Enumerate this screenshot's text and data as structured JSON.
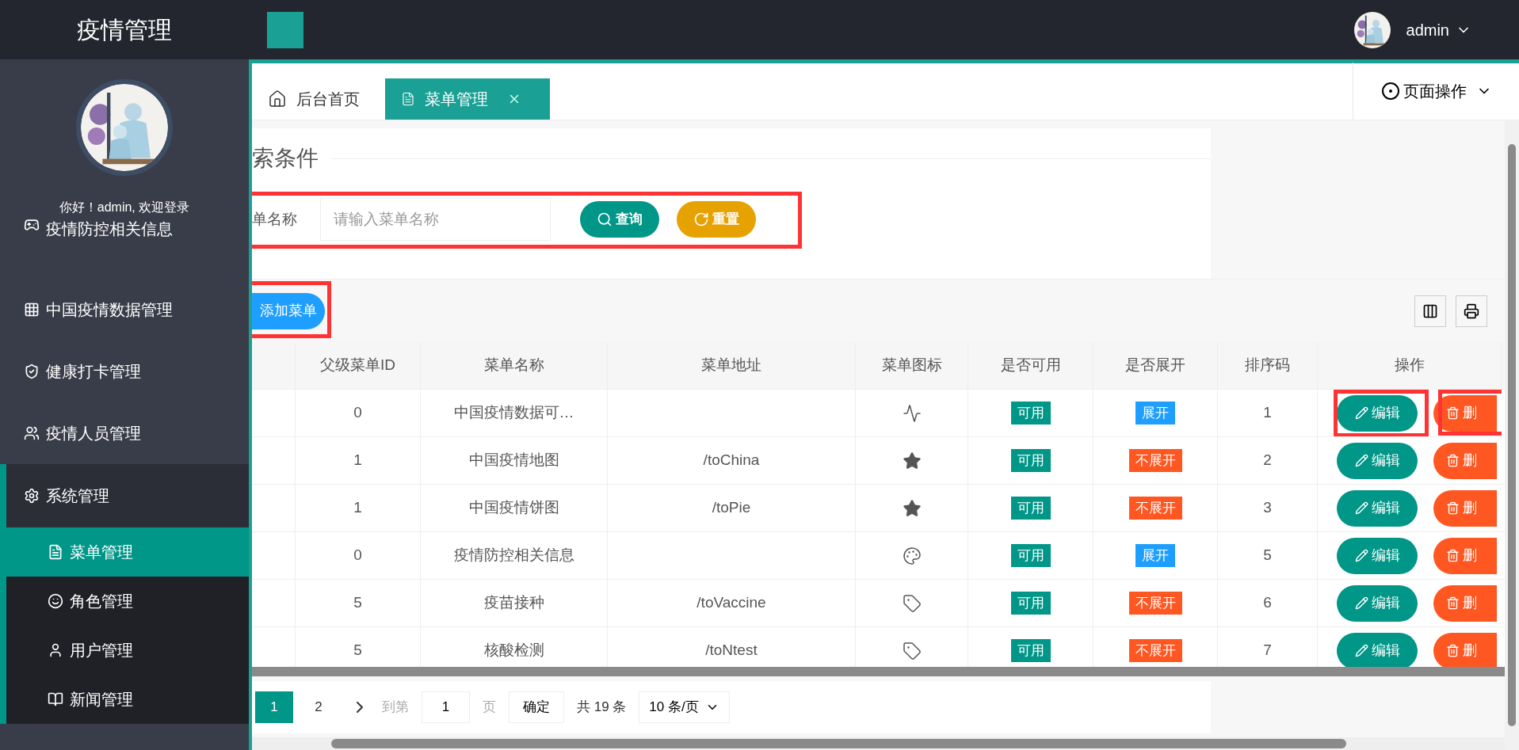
{
  "app_title": "疫情管理",
  "user": {
    "name": "admin"
  },
  "sidebar": {
    "greeting": "你好！admin, 欢迎登录",
    "items": [
      {
        "label": "疫情防控相关信息",
        "kind": "gamepad",
        "expanded": false
      },
      {
        "label": "中国疫情数据管理",
        "kind": "grid",
        "expanded": false
      },
      {
        "label": "健康打卡管理",
        "kind": "shield",
        "expanded": false
      },
      {
        "label": "疫情人员管理",
        "kind": "users",
        "expanded": false
      },
      {
        "label": "系统管理",
        "kind": "gear",
        "expanded": true,
        "children": [
          {
            "label": "菜单管理",
            "kind": "doc",
            "selected": true
          },
          {
            "label": "角色管理",
            "kind": "smile",
            "selected": false
          },
          {
            "label": "用户管理",
            "kind": "user",
            "selected": false
          },
          {
            "label": "新闻管理",
            "kind": "book",
            "selected": false
          }
        ]
      }
    ]
  },
  "tabs": [
    {
      "label": "后台首页",
      "kind": "home",
      "closable": false,
      "selected": false
    },
    {
      "label": "菜单管理",
      "kind": "doc",
      "closable": true,
      "selected": true
    }
  ],
  "page_actions": "页面操作",
  "search": {
    "title": "索条件",
    "label": "单名称",
    "placeholder": "请输入菜单名称",
    "buttons": [
      {
        "label": "查询",
        "kind": "search"
      },
      {
        "label": "重置",
        "kind": "reset"
      }
    ]
  },
  "add_button": "添加菜单",
  "table": {
    "columns": [
      "父级菜单ID",
      "菜单名称",
      "菜单地址",
      "菜单图标",
      "是否可用",
      "是否展开",
      "排序码",
      "操作"
    ],
    "rows": [
      {
        "parent_id": "0",
        "name": "中国疫情数据可…",
        "url": "",
        "kind": "pulse",
        "enabled": "可用",
        "expand": "展开",
        "expanded": true,
        "order": "1",
        "edit": "编辑",
        "delete": "删"
      },
      {
        "parent_id": "1",
        "name": "中国疫情地图",
        "url": "/toChina",
        "kind": "star",
        "enabled": "可用",
        "expand": "不展开",
        "expanded": false,
        "order": "2",
        "edit": "编辑",
        "delete": "删"
      },
      {
        "parent_id": "1",
        "name": "中国疫情饼图",
        "url": "/toPie",
        "kind": "star",
        "enabled": "可用",
        "expand": "不展开",
        "expanded": false,
        "order": "3",
        "edit": "编辑",
        "delete": "删"
      },
      {
        "parent_id": "0",
        "name": "疫情防控相关信息",
        "url": "",
        "kind": "palette",
        "enabled": "可用",
        "expand": "展开",
        "expanded": true,
        "order": "5",
        "edit": "编辑",
        "delete": "删"
      },
      {
        "parent_id": "5",
        "name": "疫苗接种",
        "url": "/toVaccine",
        "kind": "tag",
        "enabled": "可用",
        "expand": "不展开",
        "expanded": false,
        "order": "6",
        "edit": "编辑",
        "delete": "删"
      },
      {
        "parent_id": "5",
        "name": "核酸检测",
        "url": "/toNtest",
        "kind": "tag",
        "enabled": "可用",
        "expand": "不展开",
        "expanded": false,
        "order": "7",
        "edit": "编辑",
        "delete": "删"
      }
    ]
  },
  "pagination": {
    "pages": [
      {
        "label": "1",
        "selected": true
      },
      {
        "label": "2",
        "selected": false
      }
    ],
    "goto_label": "到第",
    "goto_value": "1",
    "page_unit": "页",
    "confirm": "确定",
    "total": "共 19 条",
    "page_size": "10 条/页"
  }
}
